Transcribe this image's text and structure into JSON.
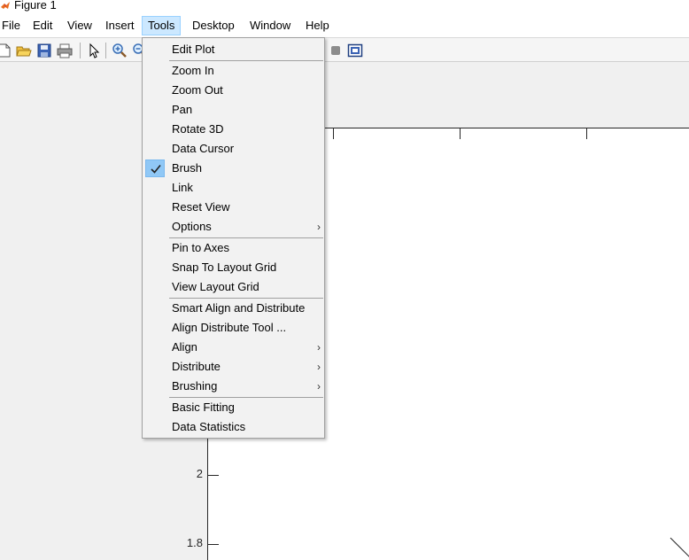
{
  "window": {
    "title": "Figure 1"
  },
  "menubar": {
    "items": [
      {
        "label": "File"
      },
      {
        "label": "Edit"
      },
      {
        "label": "View"
      },
      {
        "label": "Insert"
      },
      {
        "label": "Tools",
        "active": true
      },
      {
        "label": "Desktop"
      },
      {
        "label": "Window"
      },
      {
        "label": "Help"
      }
    ]
  },
  "toolbar": {
    "icons": [
      "new-file-icon",
      "open-folder-icon",
      "save-icon",
      "print-icon",
      "pointer-icon",
      "zoom-in-icon",
      "zoom-out-icon",
      "hide-plot-tools-icon",
      "show-plot-tools-icon"
    ]
  },
  "tools_menu": {
    "groups": [
      [
        {
          "label": "Edit Plot"
        }
      ],
      [
        {
          "label": "Zoom In"
        },
        {
          "label": "Zoom Out"
        },
        {
          "label": "Pan"
        },
        {
          "label": "Rotate 3D"
        },
        {
          "label": "Data Cursor"
        },
        {
          "label": "Brush",
          "checked": true
        },
        {
          "label": "Link"
        },
        {
          "label": "Reset View"
        },
        {
          "label": "Options",
          "submenu": true
        }
      ],
      [
        {
          "label": "Pin to Axes"
        },
        {
          "label": "Snap To Layout Grid"
        },
        {
          "label": "View Layout Grid"
        }
      ],
      [
        {
          "label": "Smart Align and Distribute"
        },
        {
          "label": "Align Distribute Tool ..."
        },
        {
          "label": "Align",
          "submenu": true
        },
        {
          "label": "Distribute",
          "submenu": true
        },
        {
          "label": "Brushing",
          "submenu": true
        }
      ],
      [
        {
          "label": "Basic Fitting"
        },
        {
          "label": "Data Statistics"
        }
      ]
    ],
    "submenu_glyph": "›"
  },
  "axes": {
    "y_tick_labels": [
      "2",
      "1.8"
    ]
  },
  "colors": {
    "menu_highlight": "#cce8ff",
    "check_highlight": "#90c8f6",
    "axes_line": "#262626"
  }
}
